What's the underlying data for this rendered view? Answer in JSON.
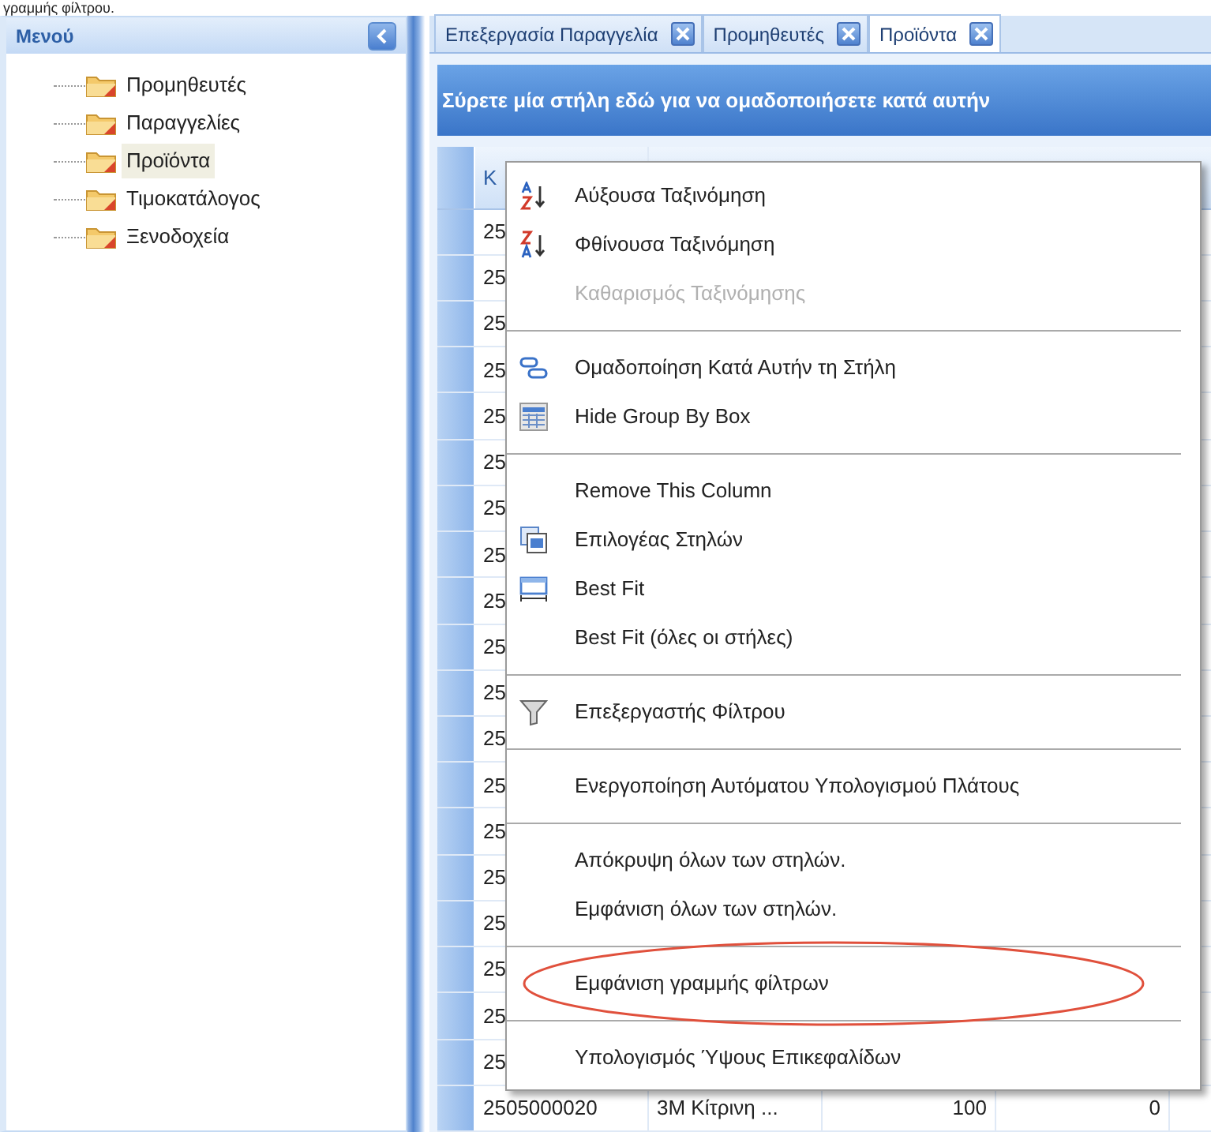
{
  "caption": "γραμμής φίλτρου.",
  "sidebar": {
    "title": "Μενού",
    "items": [
      {
        "label": "Προμηθευτές",
        "selected": false
      },
      {
        "label": "Παραγγελίες",
        "selected": false
      },
      {
        "label": "Προϊόντα",
        "selected": true
      },
      {
        "label": "Τιμοκατάλογος",
        "selected": false
      },
      {
        "label": "Ξενοδοχεία",
        "selected": false
      }
    ]
  },
  "tabs": [
    {
      "label": "Επεξεργασία Παραγγελία",
      "selected": false
    },
    {
      "label": "Προμηθευτές",
      "selected": false
    },
    {
      "label": "Προϊόντα",
      "selected": true
    }
  ],
  "group_bar": "Σύρετε μία στήλη εδώ για να ομαδοποιήσετε κατά αυτήν",
  "table": {
    "columns": [
      "K"
    ],
    "rows": [
      [
        "25"
      ],
      [
        "25"
      ],
      [
        "25"
      ],
      [
        "25"
      ],
      [
        "25"
      ],
      [
        "25"
      ],
      [
        "25"
      ],
      [
        "25"
      ],
      [
        "25"
      ],
      [
        "25"
      ],
      [
        "25"
      ],
      [
        "25"
      ],
      [
        "25"
      ],
      [
        "25"
      ],
      [
        "25"
      ],
      [
        "25"
      ],
      [
        "25"
      ],
      [
        "25"
      ],
      [
        "25"
      ],
      [
        "2505000020",
        "3M Κίτρινη ...",
        "100",
        "0"
      ]
    ]
  },
  "context_menu": [
    {
      "kind": "item",
      "label": "Αύξουσα Ταξινόμηση",
      "disabled": false,
      "highlighted": false
    },
    {
      "kind": "item",
      "label": "Φθίνουσα Ταξινόμηση",
      "disabled": false,
      "highlighted": false
    },
    {
      "kind": "item",
      "label": "Καθαρισμός Ταξινόμησης",
      "disabled": true,
      "highlighted": false
    },
    {
      "kind": "separator"
    },
    {
      "kind": "item",
      "label": "Ομαδοποίηση Κατά Αυτήν τη Στήλη",
      "disabled": false,
      "highlighted": false
    },
    {
      "kind": "item",
      "label": "Hide Group By Box",
      "disabled": false,
      "highlighted": false
    },
    {
      "kind": "separator"
    },
    {
      "kind": "item",
      "label": "Remove This Column",
      "disabled": false,
      "highlighted": false
    },
    {
      "kind": "item",
      "label": "Επιλογέας Στηλών",
      "disabled": false,
      "highlighted": false
    },
    {
      "kind": "item",
      "label": "Best Fit",
      "disabled": false,
      "highlighted": false
    },
    {
      "kind": "item",
      "label": "Best Fit (όλες οι στήλες)",
      "disabled": false,
      "highlighted": false
    },
    {
      "kind": "separator"
    },
    {
      "kind": "item",
      "label": "Επεξεργαστής Φίλτρου",
      "disabled": false,
      "highlighted": false
    },
    {
      "kind": "separator"
    },
    {
      "kind": "item",
      "label": "Ενεργοποίηση Αυτόματου Υπολογισμού Πλάτους",
      "disabled": false,
      "highlighted": false
    },
    {
      "kind": "separator"
    },
    {
      "kind": "item",
      "label": "Απόκρυψη όλων των στηλών.",
      "disabled": false,
      "highlighted": false
    },
    {
      "kind": "item",
      "label": "Εμφάνιση όλων των στηλών.",
      "disabled": false,
      "highlighted": false
    },
    {
      "kind": "separator"
    },
    {
      "kind": "item",
      "label": "Εμφάνιση γραμμής φίλτρων",
      "disabled": false,
      "highlighted": true
    },
    {
      "kind": "separator"
    },
    {
      "kind": "item",
      "label": "Υπολογισμός Ύψους Επικεφαλίδων",
      "disabled": false,
      "highlighted": false
    }
  ]
}
